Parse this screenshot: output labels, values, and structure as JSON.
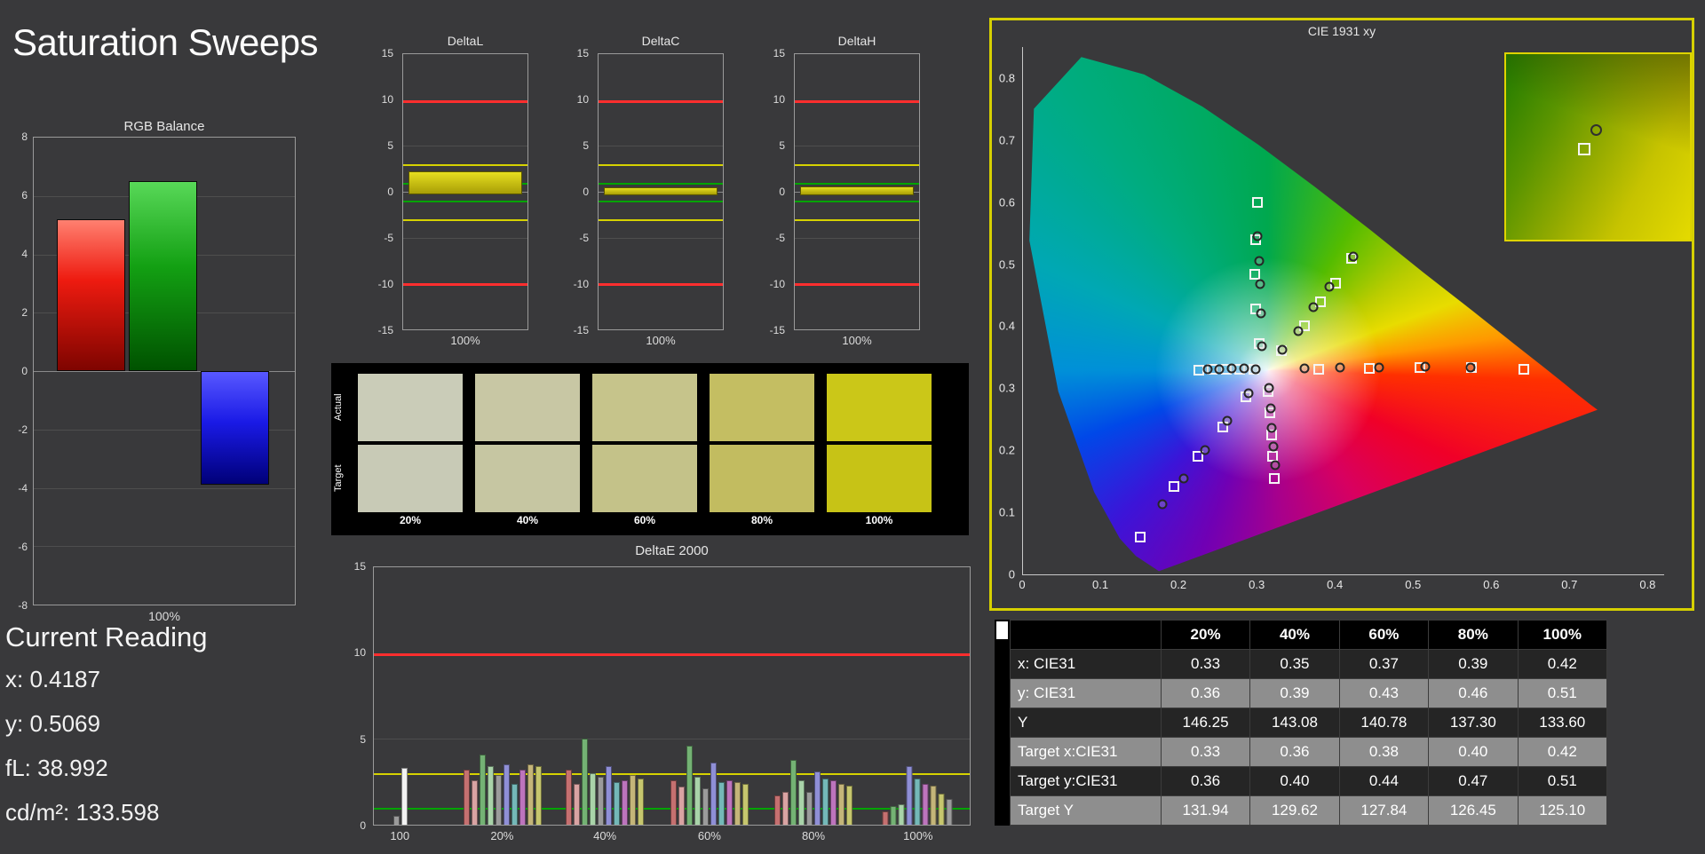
{
  "page": {
    "title": "Saturation Sweeps"
  },
  "current_reading": {
    "heading": "Current Reading",
    "lines": [
      "x: 0.4187",
      "y: 0.5069",
      "fL: 38.992",
      "cd/m²: 133.598"
    ]
  },
  "swatches": {
    "row_labels": [
      "Actual",
      "Target"
    ],
    "col_labels": [
      "20%",
      "40%",
      "60%",
      "80%",
      "100%"
    ],
    "rows": [
      {
        "name": "Actual",
        "colors": [
          "#caccb8",
          "#c8c7a4",
          "#c6c48b",
          "#c4be62",
          "#cbc718"
        ]
      },
      {
        "name": "Target",
        "colors": [
          "#c8cab6",
          "#c6c6a2",
          "#c4c289",
          "#c2bc60",
          "#c7c316"
        ]
      }
    ]
  },
  "table": {
    "col_headers": [
      "20%",
      "40%",
      "60%",
      "80%",
      "100%"
    ],
    "rows": [
      {
        "label": "x: CIE31",
        "values": [
          "0.33",
          "0.35",
          "0.37",
          "0.39",
          "0.42"
        ]
      },
      {
        "label": "y: CIE31",
        "values": [
          "0.36",
          "0.39",
          "0.43",
          "0.46",
          "0.51"
        ]
      },
      {
        "label": "Y",
        "values": [
          "146.25",
          "143.08",
          "140.78",
          "137.30",
          "133.60"
        ]
      },
      {
        "label": "Target x:CIE31",
        "values": [
          "0.33",
          "0.36",
          "0.38",
          "0.40",
          "0.42"
        ]
      },
      {
        "label": "Target y:CIE31",
        "values": [
          "0.36",
          "0.40",
          "0.44",
          "0.47",
          "0.51"
        ]
      },
      {
        "label": "Target Y",
        "values": [
          "131.94",
          "129.62",
          "127.84",
          "126.45",
          "125.10"
        ]
      }
    ]
  },
  "chart_data": [
    {
      "id": "rgb_balance",
      "type": "bar",
      "title": "RGB Balance",
      "xlabel": "100%",
      "ylim": [
        -8,
        8
      ],
      "yticks": [
        8,
        6,
        4,
        2,
        0,
        -2,
        -4,
        -6,
        -8
      ],
      "series": [
        {
          "name": "Red",
          "value": 5.2,
          "color": "#ee1b10"
        },
        {
          "name": "Green",
          "value": 6.5,
          "color": "#13a013"
        },
        {
          "name": "Blue",
          "value": -3.9,
          "color": "#1a1ae6"
        }
      ]
    },
    {
      "id": "deltaL",
      "type": "bar",
      "title": "DeltaL",
      "xlabel": "100%",
      "ylim": [
        -15,
        15
      ],
      "yticks": [
        15,
        10,
        5,
        0,
        -5,
        -10,
        -15
      ],
      "limit_lines": [
        {
          "value": 10,
          "color": "#ff2e2e"
        },
        {
          "value": -10,
          "color": "#ff2e2e"
        },
        {
          "value": 3,
          "color": "#d6d200"
        },
        {
          "value": -3,
          "color": "#d6d200"
        },
        {
          "value": 1,
          "color": "#00a400"
        },
        {
          "value": -1,
          "color": "#00a400"
        }
      ],
      "value": 1.9,
      "bar_span": [
        -0.3,
        2.2
      ]
    },
    {
      "id": "deltaC",
      "type": "bar",
      "title": "DeltaC",
      "xlabel": "100%",
      "ylim": [
        -15,
        15
      ],
      "yticks": [
        15,
        10,
        5,
        0,
        -5,
        -10,
        -15
      ],
      "limit_lines": [
        {
          "value": 10,
          "color": "#ff2e2e"
        },
        {
          "value": -10,
          "color": "#ff2e2e"
        },
        {
          "value": 3,
          "color": "#d6d200"
        },
        {
          "value": -3,
          "color": "#d6d200"
        },
        {
          "value": 1,
          "color": "#00a400"
        },
        {
          "value": -1,
          "color": "#00a400"
        }
      ],
      "value": 0.3,
      "bar_span": [
        -0.35,
        0.5
      ]
    },
    {
      "id": "deltaH",
      "type": "bar",
      "title": "DeltaH",
      "xlabel": "100%",
      "ylim": [
        -15,
        15
      ],
      "yticks": [
        15,
        10,
        5,
        0,
        -5,
        -10,
        -15
      ],
      "limit_lines": [
        {
          "value": 10,
          "color": "#ff2e2e"
        },
        {
          "value": -10,
          "color": "#ff2e2e"
        },
        {
          "value": 3,
          "color": "#d6d200"
        },
        {
          "value": -3,
          "color": "#d6d200"
        },
        {
          "value": 1,
          "color": "#00a400"
        },
        {
          "value": -1,
          "color": "#00a400"
        }
      ],
      "value": 0.35,
      "bar_span": [
        -0.35,
        0.6
      ]
    },
    {
      "id": "deltae2000",
      "type": "grouped-bar",
      "title": "DeltaE 2000",
      "ylim": [
        0,
        15
      ],
      "yticks": [
        15,
        10,
        5,
        0
      ],
      "limit_lines": [
        {
          "value": 10,
          "color": "#ff2e2e"
        },
        {
          "value": 3,
          "color": "#d6d200"
        },
        {
          "value": 1,
          "color": "#00a400"
        }
      ],
      "groups": [
        {
          "label": "100",
          "bars": [
            {
              "value": 0.5,
              "color": "#9b9b9b"
            },
            {
              "value": 3.3,
              "color": "#f2f2f2"
            }
          ]
        },
        {
          "label": "20%",
          "bars": [
            {
              "value": 3.2,
              "color": "#c57070"
            },
            {
              "value": 2.6,
              "color": "#d9a3a3"
            },
            {
              "value": 4.1,
              "color": "#74b274"
            },
            {
              "value": 3.4,
              "color": "#a9d3a9"
            },
            {
              "value": 2.9,
              "color": "#9b9b9b"
            },
            {
              "value": 3.5,
              "color": "#8f8fd6"
            },
            {
              "value": 2.4,
              "color": "#74b8b8"
            },
            {
              "value": 3.2,
              "color": "#bd74bd"
            },
            {
              "value": 3.5,
              "color": "#c4b579"
            },
            {
              "value": 3.4,
              "color": "#c6c66e"
            }
          ]
        },
        {
          "label": "40%",
          "bars": [
            {
              "value": 3.2,
              "color": "#c57070"
            },
            {
              "value": 2.4,
              "color": "#d9a3a3"
            },
            {
              "value": 5.0,
              "color": "#74b274"
            },
            {
              "value": 3.0,
              "color": "#a9d3a9"
            },
            {
              "value": 2.8,
              "color": "#9b9b9b"
            },
            {
              "value": 3.4,
              "color": "#8f8fd6"
            },
            {
              "value": 2.5,
              "color": "#74b8b8"
            },
            {
              "value": 2.6,
              "color": "#bd74bd"
            },
            {
              "value": 2.9,
              "color": "#c4b579"
            },
            {
              "value": 2.7,
              "color": "#c6c66e"
            }
          ]
        },
        {
          "label": "60%",
          "bars": [
            {
              "value": 2.6,
              "color": "#c57070"
            },
            {
              "value": 2.2,
              "color": "#d9a3a3"
            },
            {
              "value": 4.6,
              "color": "#74b274"
            },
            {
              "value": 2.8,
              "color": "#a9d3a9"
            },
            {
              "value": 2.1,
              "color": "#9b9b9b"
            },
            {
              "value": 3.6,
              "color": "#8f8fd6"
            },
            {
              "value": 2.5,
              "color": "#74b8b8"
            },
            {
              "value": 2.6,
              "color": "#bd74bd"
            },
            {
              "value": 2.5,
              "color": "#c4b579"
            },
            {
              "value": 2.4,
              "color": "#c6c66e"
            }
          ]
        },
        {
          "label": "80%",
          "bars": [
            {
              "value": 1.7,
              "color": "#c57070"
            },
            {
              "value": 1.9,
              "color": "#d9a3a3"
            },
            {
              "value": 3.8,
              "color": "#74b274"
            },
            {
              "value": 2.6,
              "color": "#a9d3a9"
            },
            {
              "value": 1.9,
              "color": "#9b9b9b"
            },
            {
              "value": 3.1,
              "color": "#8f8fd6"
            },
            {
              "value": 2.7,
              "color": "#74b8b8"
            },
            {
              "value": 2.6,
              "color": "#bd74bd"
            },
            {
              "value": 2.4,
              "color": "#c4b579"
            },
            {
              "value": 2.3,
              "color": "#c6c66e"
            }
          ]
        },
        {
          "label": "100%",
          "bars": [
            {
              "value": 0.8,
              "color": "#c57070"
            },
            {
              "value": 1.1,
              "color": "#74b274"
            },
            {
              "value": 1.2,
              "color": "#a9d3a9"
            },
            {
              "value": 3.4,
              "color": "#8f8fd6"
            },
            {
              "value": 2.7,
              "color": "#74b8b8"
            },
            {
              "value": 2.4,
              "color": "#bd74bd"
            },
            {
              "value": 2.3,
              "color": "#c4b579"
            },
            {
              "value": 1.8,
              "color": "#c6c66e"
            },
            {
              "value": 1.5,
              "color": "#9b9b9b"
            }
          ]
        }
      ]
    },
    {
      "id": "cie1931",
      "type": "scatter",
      "title": "CIE 1931 xy",
      "xticks": [
        0,
        0.1,
        0.2,
        0.3,
        0.4,
        0.5,
        0.6,
        0.7,
        0.8
      ],
      "yticks": [
        0.8,
        0.7,
        0.6,
        0.5,
        0.4,
        0.3,
        0.2,
        0.1,
        0
      ],
      "white_point": [
        0.313,
        0.329
      ],
      "sweeps": [
        {
          "name": "red",
          "targets": [
            [
              0.378,
              0.331
            ],
            [
              0.443,
              0.332
            ],
            [
              0.508,
              0.333
            ],
            [
              0.573,
              0.334
            ],
            [
              0.64,
              0.33
            ]
          ],
          "measured": [
            [
              0.36,
              0.332
            ],
            [
              0.405,
              0.333
            ],
            [
              0.455,
              0.334
            ],
            [
              0.515,
              0.335
            ],
            [
              0.572,
              0.334
            ]
          ]
        },
        {
          "name": "green",
          "targets": [
            [
              0.302,
              0.372
            ],
            [
              0.298,
              0.428
            ],
            [
              0.296,
              0.484
            ],
            [
              0.297,
              0.54
            ],
            [
              0.3,
              0.6
            ]
          ],
          "measured": [
            [
              0.306,
              0.368
            ],
            [
              0.304,
              0.42
            ],
            [
              0.303,
              0.468
            ],
            [
              0.302,
              0.505
            ],
            [
              0.3,
              0.545
            ]
          ]
        },
        {
          "name": "blue",
          "targets": [
            [
              0.285,
              0.286
            ],
            [
              0.255,
              0.238
            ],
            [
              0.224,
              0.19
            ],
            [
              0.193,
              0.141
            ],
            [
              0.15,
              0.06
            ]
          ],
          "measured": [
            [
              0.289,
              0.292
            ],
            [
              0.261,
              0.247
            ],
            [
              0.233,
              0.201
            ],
            [
              0.205,
              0.155
            ],
            [
              0.178,
              0.113
            ]
          ]
        },
        {
          "name": "yellow",
          "targets": [
            [
              0.33,
              0.36
            ],
            [
              0.36,
              0.4
            ],
            [
              0.38,
              0.44
            ],
            [
              0.4,
              0.47
            ],
            [
              0.42,
              0.51
            ]
          ],
          "measured": [
            [
              0.332,
              0.362
            ],
            [
              0.352,
              0.392
            ],
            [
              0.371,
              0.431
            ],
            [
              0.392,
              0.463
            ],
            [
              0.423,
              0.513
            ]
          ]
        },
        {
          "name": "cyan",
          "targets": [
            [
              0.295,
              0.33
            ],
            [
              0.277,
              0.33
            ],
            [
              0.26,
              0.33
            ],
            [
              0.242,
              0.33
            ],
            [
              0.225,
              0.329
            ]
          ],
          "measured": [
            [
              0.298,
              0.331
            ],
            [
              0.283,
              0.332
            ],
            [
              0.267,
              0.332
            ],
            [
              0.251,
              0.331
            ],
            [
              0.236,
              0.33
            ]
          ]
        },
        {
          "name": "magenta",
          "targets": [
            [
              0.314,
              0.295
            ],
            [
              0.316,
              0.26
            ],
            [
              0.318,
              0.225
            ],
            [
              0.319,
              0.19
            ],
            [
              0.321,
              0.154
            ]
          ],
          "measured": [
            [
              0.315,
              0.3
            ],
            [
              0.317,
              0.268
            ],
            [
              0.318,
              0.236
            ],
            [
              0.32,
              0.206
            ],
            [
              0.322,
              0.176
            ]
          ]
        }
      ]
    }
  ]
}
